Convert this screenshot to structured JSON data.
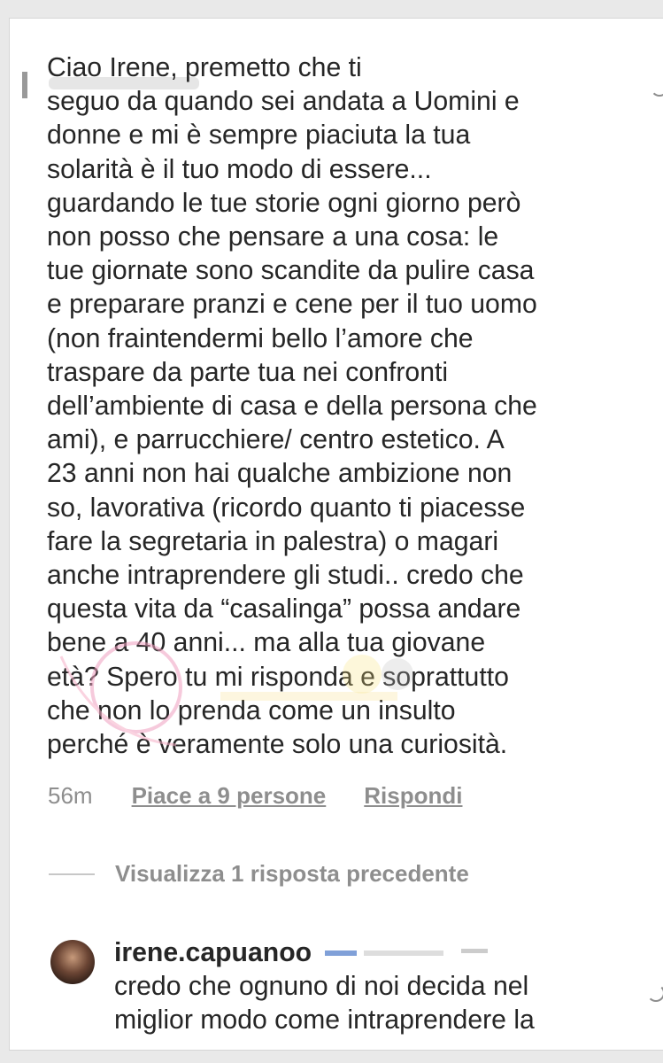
{
  "comment": {
    "text": "Ciao Irene, premetto che ti\nseguo da quando sei andata a Uomini e\ndonne e mi è sempre piaciuta la tua\nsolarità è il tuo modo di essere...\nguardando le tue storie ogni giorno però\nnon posso che pensare a una cosa: le\ntue giornate sono scandite da pulire casa\ne preparare pranzi e cene per il tuo uomo\n(non fraintendermi bello l’amore che\ntraspare da parte tua nei confronti\ndell’ambiente di casa e della persona che\nami), e parrucchiere/ centro estetico. A\n23 anni non hai qualche ambizione non\nso, lavorativa (ricordo quanto ti piacesse\nfare la segretaria in palestra) o magari\nanche intraprendere gli studi.. credo che\nquesta vita da “casalinga” possa andare\nbene a 40 anni... ma alla tua giovane\netà? Spero tu mi risponda e soprattutto\nche non lo prenda come un insulto\nperché è veramente solo una curiosità.",
    "time": "56m",
    "likes": "Piace a 9 persone",
    "reply_label": "Rispondi"
  },
  "replies_toggle": "Visualizza 1 risposta precedente",
  "reply": {
    "username": "irene.capuanoo",
    "text": "credo che ognuno di noi decida nel\nmiglior modo come intraprendere la"
  },
  "colors": {
    "text": "#262626",
    "secondary": "#8e8e8e",
    "background": "#ffffff"
  },
  "icons": [
    "heart-icon",
    "avatar"
  ]
}
